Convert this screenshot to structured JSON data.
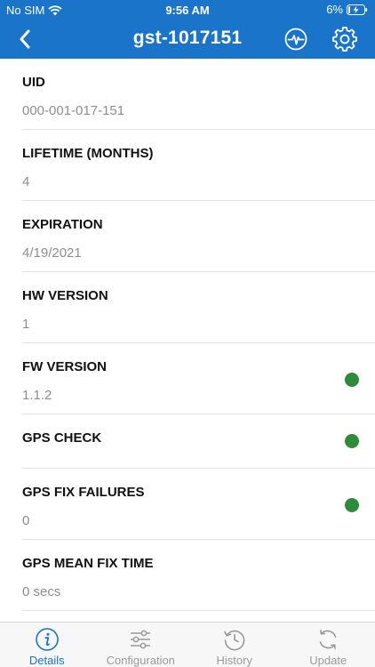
{
  "status_bar": {
    "carrier": "No SIM",
    "time": "9:56 AM",
    "battery": "6%"
  },
  "nav": {
    "title": "gst-1017151"
  },
  "details": [
    {
      "label": "UID",
      "value": "000-001-017-151",
      "status": null
    },
    {
      "label": "LIFETIME (MONTHS)",
      "value": "4",
      "status": null
    },
    {
      "label": "EXPIRATION",
      "value": "4/19/2021",
      "status": null
    },
    {
      "label": "HW VERSION",
      "value": "1",
      "status": null
    },
    {
      "label": "FW VERSION",
      "value": "1.1.2",
      "status": "ok"
    },
    {
      "label": "GPS CHECK",
      "value": "",
      "status": "ok"
    },
    {
      "label": "GPS FIX FAILURES",
      "value": "0",
      "status": "ok"
    },
    {
      "label": "GPS MEAN FIX TIME",
      "value": "0 secs",
      "status": null
    }
  ],
  "tabs": [
    {
      "label": "Details",
      "icon": "info-icon",
      "active": true
    },
    {
      "label": "Configuration",
      "icon": "sliders-icon",
      "active": false
    },
    {
      "label": "History",
      "icon": "history-icon",
      "active": false
    },
    {
      "label": "Update",
      "icon": "refresh-icon",
      "active": false
    }
  ],
  "colors": {
    "primary": "#1a74c9",
    "status_ok": "#2e8b3a",
    "value_text": "#8d8d8d",
    "inactive_tab": "#9a9a9a"
  }
}
